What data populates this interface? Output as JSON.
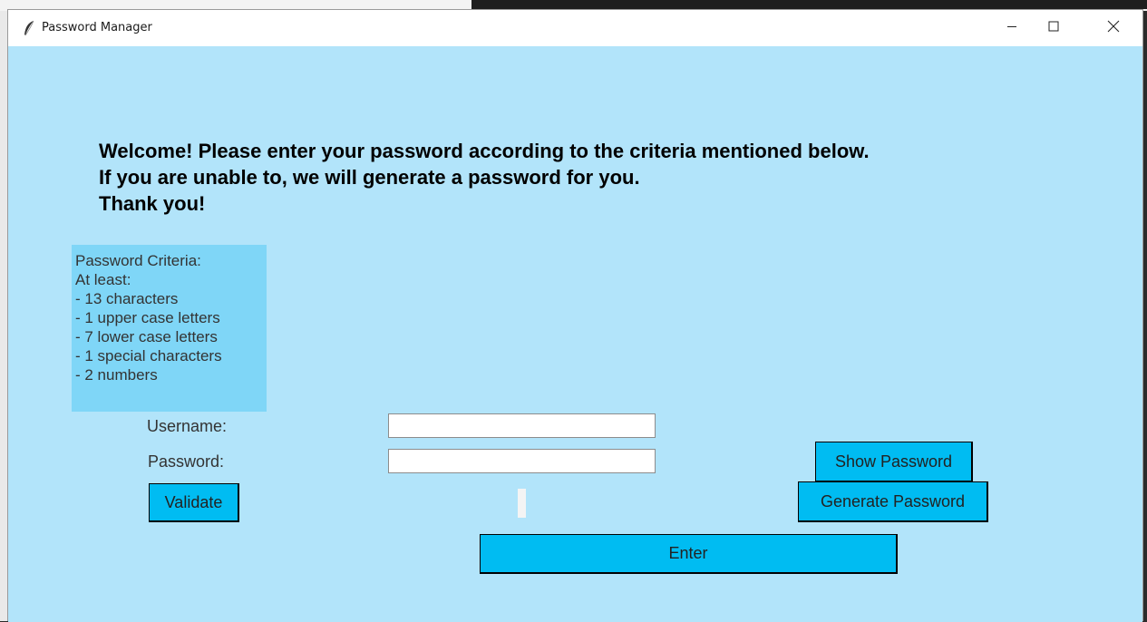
{
  "window": {
    "title": "Password Manager"
  },
  "welcome": {
    "text": "Welcome! Please enter your password according to the criteria mentioned below.\nIf you are unable to, we will generate a password for you.\nThank you!"
  },
  "criteria": {
    "text": "Password Criteria:\nAt least:\n- 13 characters\n- 1 upper case letters\n- 7 lower case letters\n- 1 special characters\n- 2 numbers"
  },
  "form": {
    "username_label": "Username:",
    "password_label": "Password:",
    "username_value": "",
    "password_value": ""
  },
  "buttons": {
    "show_password": "Show Password",
    "generate_password": "Generate Password",
    "validate": "Validate",
    "enter": "Enter"
  },
  "colors": {
    "background": "#b2e4fa",
    "criteria_bg": "#7fd6f7",
    "button": "#00bcf2"
  },
  "icons": {
    "app": "feather-icon",
    "minimize": "minimize-icon",
    "maximize": "maximize-icon",
    "close": "close-icon"
  }
}
